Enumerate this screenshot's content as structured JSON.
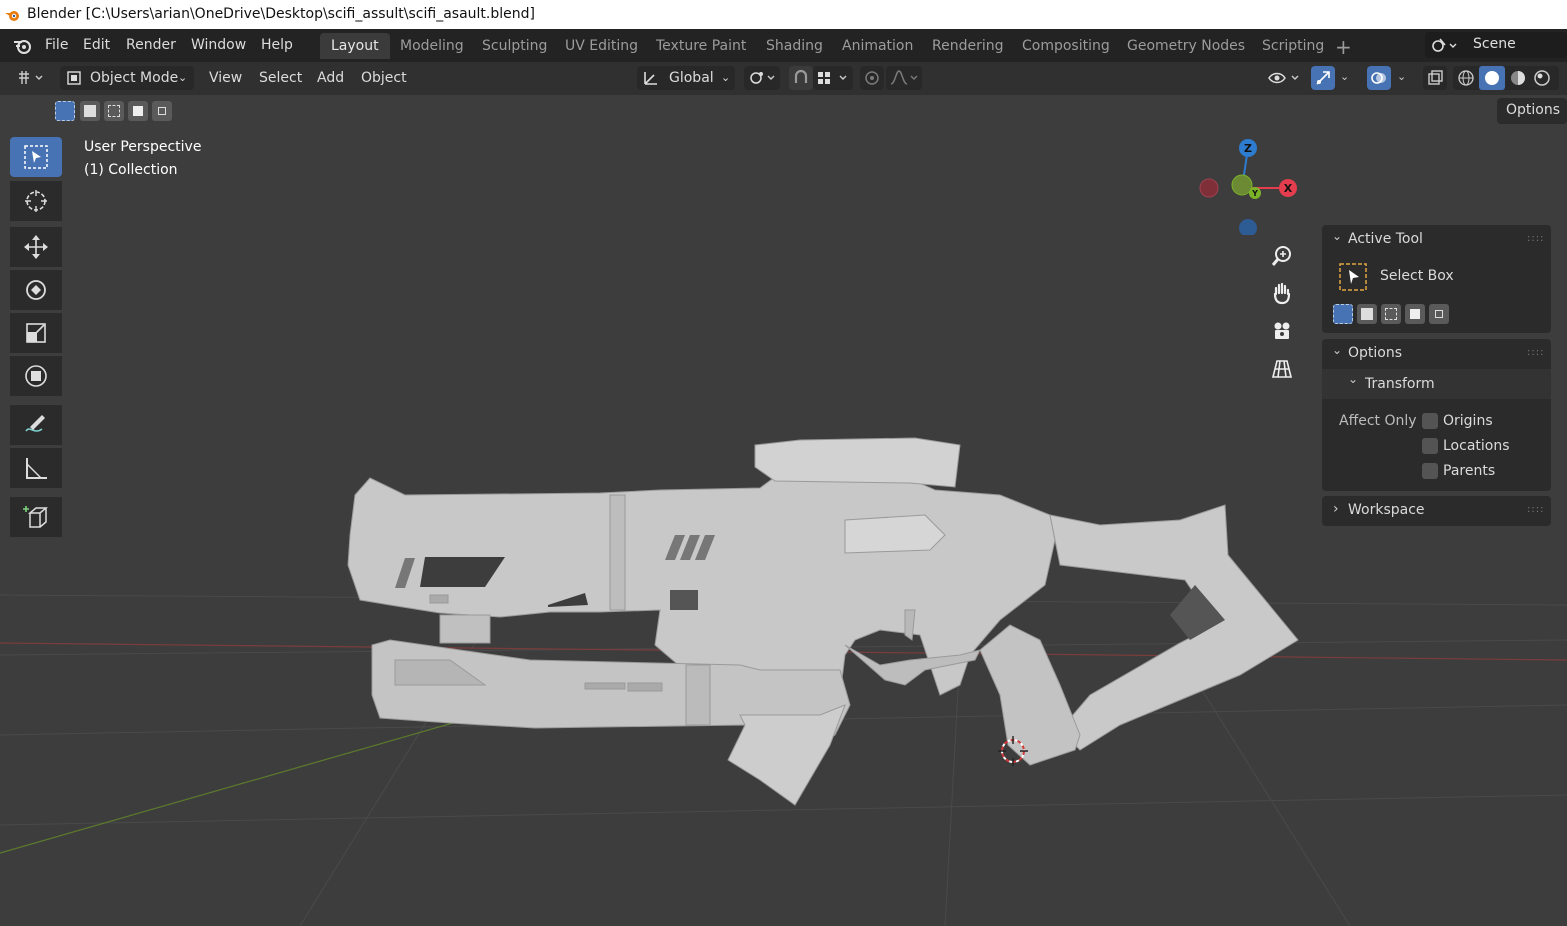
{
  "window": {
    "title": "Blender [C:\\Users\\arian\\OneDrive\\Desktop\\scifi_assult\\scifi_asault.blend]"
  },
  "topbar": {
    "menus": [
      "File",
      "Edit",
      "Render",
      "Window",
      "Help"
    ],
    "tabs": [
      "Layout",
      "Modeling",
      "Sculpting",
      "UV Editing",
      "Texture Paint",
      "Shading",
      "Animation",
      "Rendering",
      "Compositing",
      "Geometry Nodes",
      "Scripting"
    ],
    "active_tab": "Layout",
    "scene": "Scene"
  },
  "header": {
    "mode": "Object Mode",
    "menus": [
      "View",
      "Select",
      "Add",
      "Object"
    ],
    "orientation": "Global",
    "options_label": "Options"
  },
  "viewport": {
    "view_name": "User Perspective",
    "collection": "(1) Collection",
    "gizmo_axes": {
      "z": "Z",
      "x": "X",
      "y": "Y"
    }
  },
  "sidebar": {
    "active_tool": {
      "heading": "Active Tool",
      "tool_name": "Select Box"
    },
    "options": {
      "heading": "Options",
      "transform": "Transform",
      "affect_only": "Affect Only",
      "checkboxes": [
        {
          "label": "Origins",
          "checked": false
        },
        {
          "label": "Locations",
          "checked": false
        },
        {
          "label": "Parents",
          "checked": false
        }
      ]
    },
    "workspace": {
      "heading": "Workspace"
    }
  },
  "colors": {
    "accent": "#4772b3",
    "axis_x": "#e33d4e",
    "axis_y": "#7cb428",
    "axis_z": "#2e7ccf",
    "cursor": "#d33a3a"
  },
  "icons": [
    "blender-logo-icon",
    "editor-type-icon",
    "object-mode-icon",
    "orientation-icon",
    "pivot-icon",
    "snap-icon",
    "proportional-icon",
    "visibility-icon",
    "gizmo-icon",
    "overlay-icon",
    "xray-icon",
    "shading-wire-icon",
    "shading-solid-icon",
    "shading-material-icon",
    "shading-rendered-icon",
    "select-box-tool-icon",
    "cursor-tool-icon",
    "move-tool-icon",
    "rotate-tool-icon",
    "scale-tool-icon",
    "transform-tool-icon",
    "annotate-tool-icon",
    "measure-tool-icon",
    "add-cube-tool-icon",
    "zoom-icon",
    "hand-icon",
    "camera-icon",
    "grid-icon"
  ]
}
